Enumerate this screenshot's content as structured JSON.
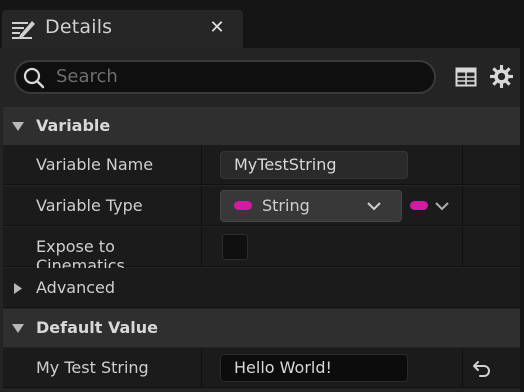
{
  "tab": {
    "title": "Details",
    "icon": "edit-pencil-icon",
    "close_label": "✕"
  },
  "toolbar": {
    "search_placeholder": "Search",
    "view_options_icon": "table-icon",
    "settings_icon": "gear-icon"
  },
  "sections": [
    {
      "label": "Variable",
      "expanded": true,
      "rows": [
        {
          "name": "Variable Name",
          "value": "MyTestString"
        },
        {
          "name": "Variable Type",
          "value": "String",
          "pin_color": "#d21ba0"
        },
        {
          "name": "Expose to Cinematics",
          "checked": false
        }
      ]
    },
    {
      "label": "Advanced",
      "expanded": false
    },
    {
      "label": "Default Value",
      "expanded": true,
      "rows": [
        {
          "name": "My Test String",
          "value": "Hello World!"
        }
      ]
    }
  ],
  "colors": {
    "string_pin": "#d21ba0",
    "panel_bg": "#242424",
    "header_bg": "#2f2f2f",
    "row_bg": "#1b1b1b"
  }
}
